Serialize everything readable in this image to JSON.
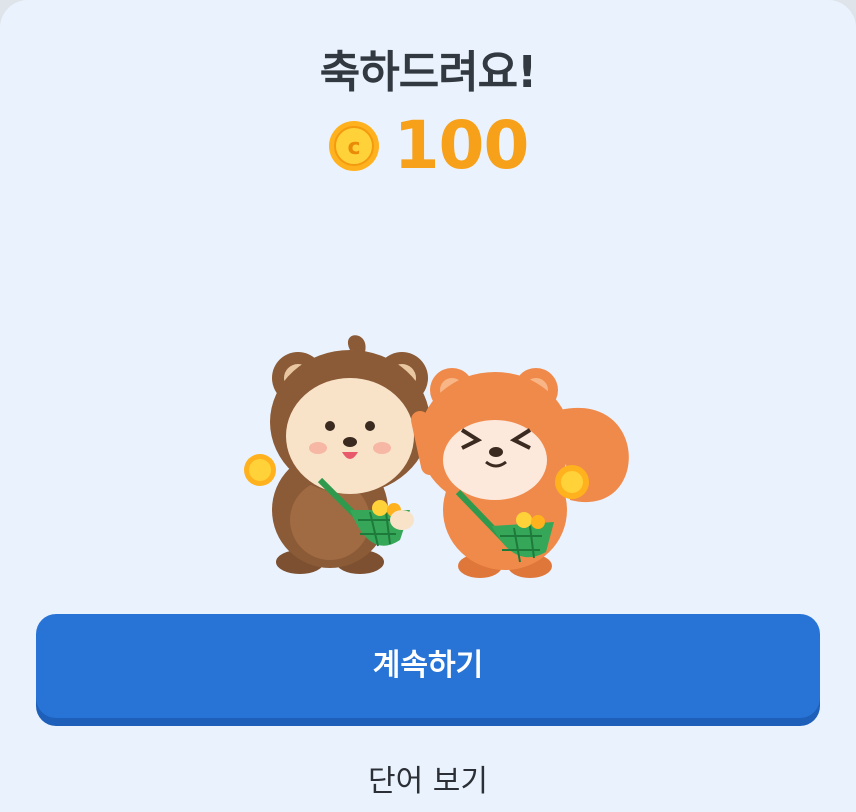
{
  "dialog": {
    "title": "축하드려요!",
    "reward_amount": "100",
    "coin_icon": "coin-icon",
    "illustration": "two-mascots-with-coins-illustration",
    "continue_label": "계속하기",
    "view_words_label": "단어 보기"
  },
  "colors": {
    "background": "#eaf3fd",
    "title": "#333940",
    "reward": "#f7a11a",
    "button": "#2874d6",
    "button_shadow": "#1d5fb9"
  }
}
